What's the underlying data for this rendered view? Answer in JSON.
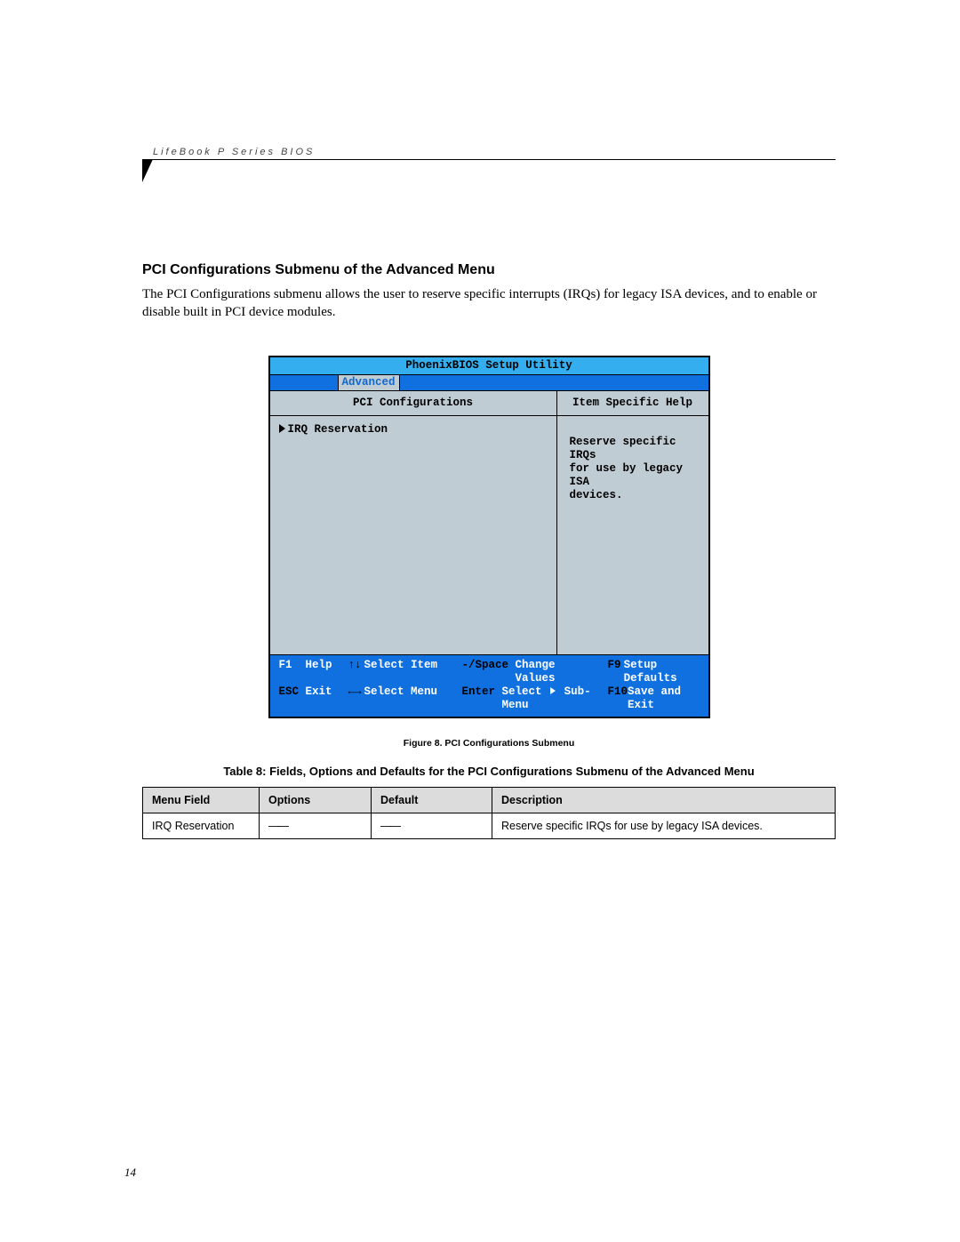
{
  "header_label": "LifeBook P Series BIOS",
  "section_title": "PCI Configurations Submenu of the Advanced Menu",
  "body_text": "The PCI Configurations submenu allows the user to reserve specific interrupts (IRQs) for legacy ISA devices, and to enable or disable built in PCI device modules.",
  "bios": {
    "title": "PhoenixBIOS Setup Utility",
    "active_tab": "Advanced",
    "left_heading": "PCI Configurations",
    "menu_item": "IRQ Reservation",
    "right_heading": "Item Specific Help",
    "help_text": "Reserve specific IRQs\nfor use by legacy ISA\ndevices.",
    "footer": {
      "r1": {
        "k1": "F1",
        "l1": "Help",
        "k2": "↑↓",
        "l2": "Select Item",
        "k3": "-/Space",
        "l3": "Change Values",
        "k4": "F9",
        "l4": "Setup Defaults"
      },
      "r2": {
        "k1": "ESC",
        "l1": "Exit",
        "k2": "←→",
        "l2": "Select Menu",
        "k3": "Enter",
        "l3a": "Select",
        "l3b": "Sub-Menu",
        "k4": "F10",
        "l4": "Save and Exit"
      }
    }
  },
  "figure_caption": "Figure 8.  PCI Configurations Submenu",
  "table_title": "Table 8: Fields, Options and Defaults for the PCI Configurations Submenu of the Advanced Menu",
  "table": {
    "headers": [
      "Menu Field",
      "Options",
      "Default",
      "Description"
    ],
    "row": {
      "menu_field": "IRQ Reservation",
      "options": "——",
      "default": "——",
      "description": "Reserve specific IRQs for use by legacy ISA devices."
    }
  },
  "page_number": "14"
}
